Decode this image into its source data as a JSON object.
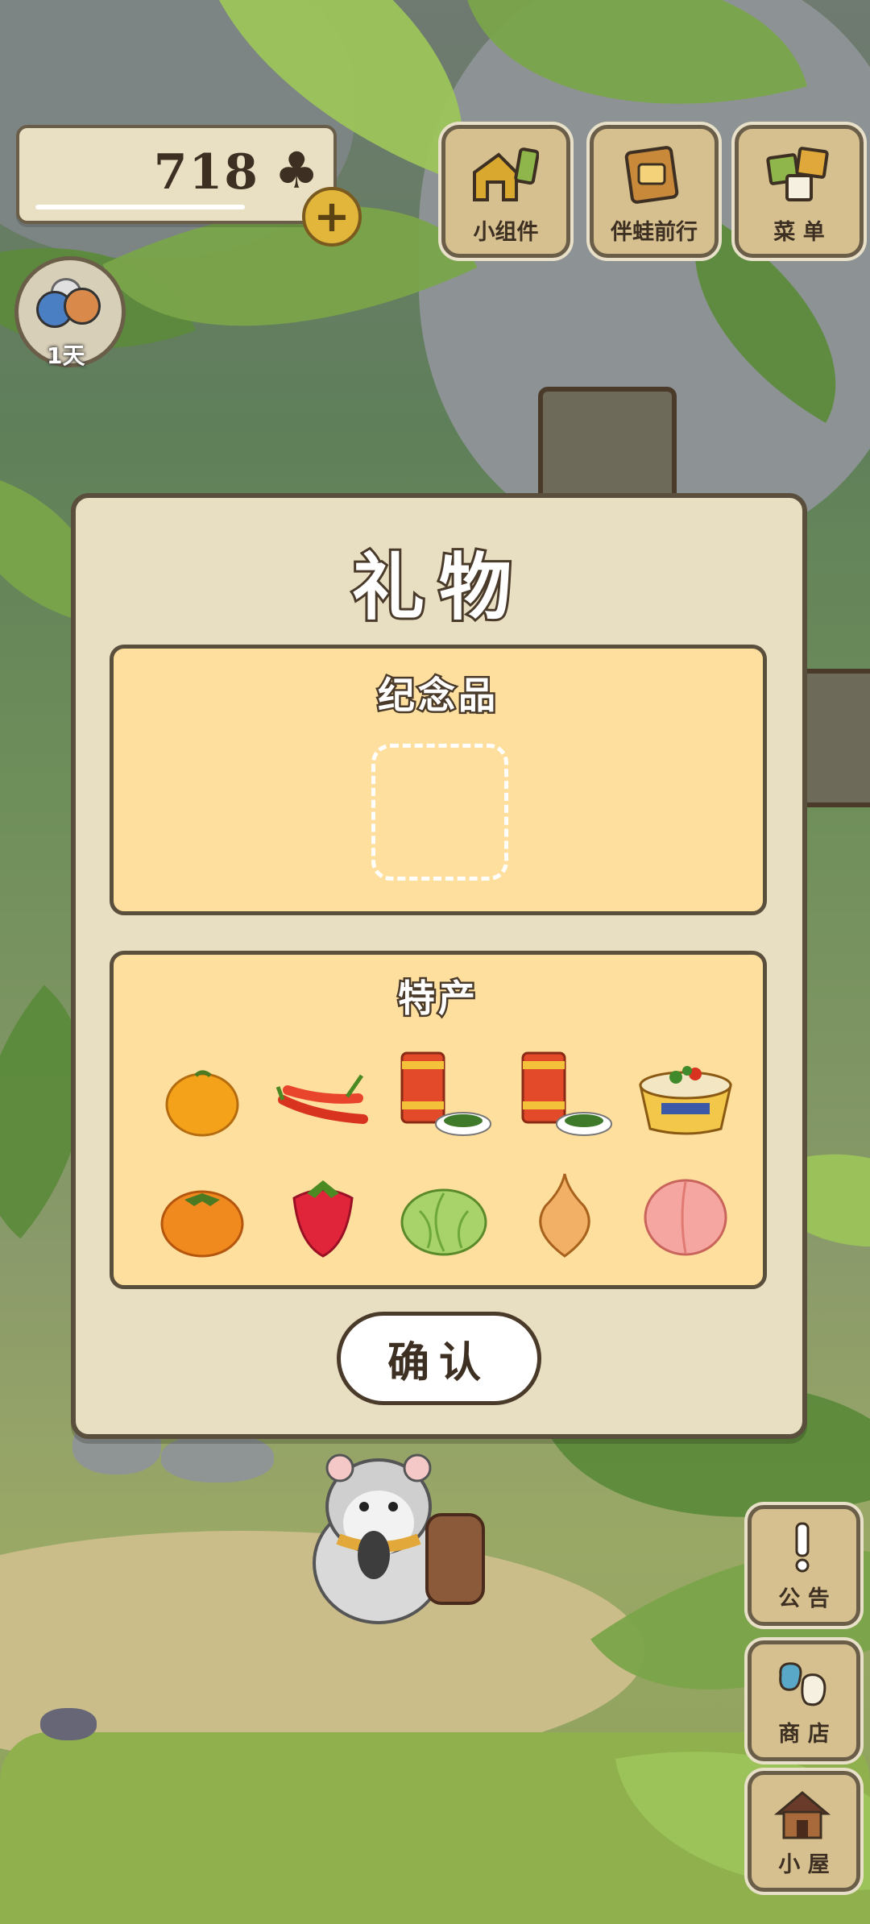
{
  "hud": {
    "clover_count": "718",
    "clover_symbol": "♣",
    "add_symbol": "+",
    "day_label": "1天"
  },
  "top_buttons": {
    "widgets": "小组件",
    "travel_with_frog": "伴蛙前行",
    "menu": "菜 单"
  },
  "side_buttons": {
    "notice": "公 告",
    "shop": "商 店",
    "hut": "小 屋"
  },
  "dialog": {
    "title": "礼物",
    "souvenir_title": "纪念品",
    "specialty_title": "特产",
    "specialty_items": [
      {
        "icon": "orange-icon"
      },
      {
        "icon": "chili-pepper-icon"
      },
      {
        "icon": "canned-food-icon"
      },
      {
        "icon": "canned-food-icon"
      },
      {
        "icon": "noodle-bowl-icon"
      },
      {
        "icon": "persimmon-icon"
      },
      {
        "icon": "strawberry-icon"
      },
      {
        "icon": "cabbage-icon"
      },
      {
        "icon": "onion-icon"
      },
      {
        "icon": "peach-icon"
      }
    ],
    "confirm_label": "确认"
  },
  "colors": {
    "dialog_bg": "#e8dfc2",
    "panel_bg": "#ffdf9d",
    "border": "#5a4e3c",
    "button_wood": "#d6c090"
  }
}
